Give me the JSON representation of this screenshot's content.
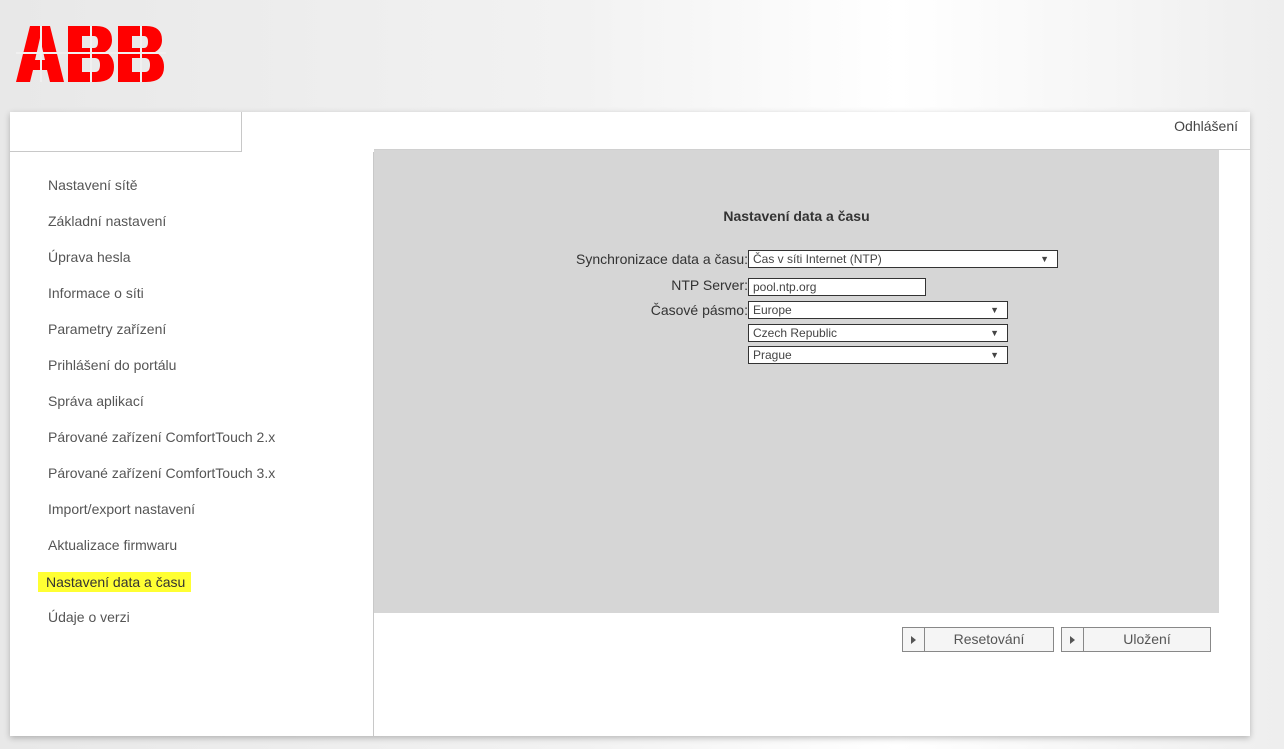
{
  "brand": {
    "logo_text": "ABB",
    "logo_color": "#ff0000"
  },
  "header": {
    "logout_label": "Odhlášení"
  },
  "sidebar": {
    "items": [
      {
        "label": "Nastavení sítě"
      },
      {
        "label": "Základní nastavení"
      },
      {
        "label": "Úprava hesla"
      },
      {
        "label": "Informace o síti"
      },
      {
        "label": "Parametry zařízení"
      },
      {
        "label": "Prihlášení do portálu"
      },
      {
        "label": "Správa aplikací"
      },
      {
        "label": "Párované zařízení ComfortTouch 2.x"
      },
      {
        "label": "Párované zařízení ComfortTouch 3.x"
      },
      {
        "label": "Import/export nastavení"
      },
      {
        "label": "Aktualizace firmwaru"
      },
      {
        "label": "Nastavení data a času",
        "active": true
      },
      {
        "label": "Údaje o verzi"
      }
    ],
    "highlight_color": "#ffff33"
  },
  "main": {
    "title": "Nastavení data a času",
    "sync": {
      "label": "Synchronizace data a času:",
      "value": "Čas v síti Internet (NTP)"
    },
    "ntp": {
      "label": "NTP Server:",
      "value": "pool.ntp.org"
    },
    "timezone": {
      "label": "Časové pásmo:",
      "region": "Europe",
      "country": "Czech Republic",
      "city": "Prague"
    },
    "panel_color": "#d6d6d6"
  },
  "buttons": {
    "reset_label": "Resetování",
    "save_label": "Uložení"
  }
}
